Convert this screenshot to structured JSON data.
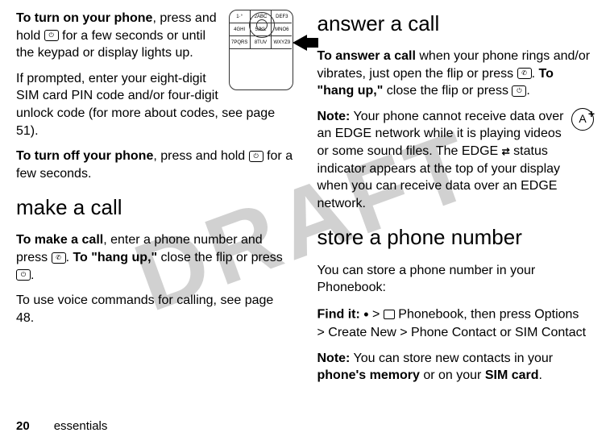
{
  "watermark": "DRAFT",
  "col1": {
    "p1a": "To turn on your phone",
    "p1b": ", press and hold ",
    "p1c": " for a few seconds or until the keypad or display lights up.",
    "p2": "If prompted, enter your eight-digit SIM card PIN code and/or four-digit unlock code (for more about codes, see page 51).",
    "p3a": "To turn off your phone",
    "p3b": ", press and hold ",
    "p3c": " for a few seconds.",
    "h_make": "make a call",
    "p4a": "To make a call",
    "p4b": ", enter a phone number and press ",
    "p4c": ". ",
    "p4d": "To \"hang up,\"",
    "p4e": " close the flip or press ",
    "p4f": ".",
    "p5": "To use voice commands for calling, see page 48.",
    "keys": [
      "1·°",
      "2ABC",
      "DEF3",
      "4GHI",
      "5JKL",
      "MNO6",
      "7PQRS",
      "8TUV",
      "WXYZ9"
    ]
  },
  "col2": {
    "h_answer": "answer a call",
    "p1a": "To answer a call",
    "p1b": " when your phone rings and/or vibrates, just open the flip or press ",
    "p1c": ". ",
    "p1d": "To \"hang up,\"",
    "p1e": " close the flip or press ",
    "p1f": ".",
    "p2a": "Note:",
    "p2b": " Your phone cannot receive data over an EDGE network while it is playing videos or some sound files. The EDGE ",
    "p2c": " status indicator appears at the top of your display when you can receive data over an EDGE network.",
    "h_store": "store a phone number",
    "p3a": "You can store a phone number in your ",
    "p3b": "Phonebook",
    "p3c": ":",
    "p4a": "Find it:",
    "p4b": " > ",
    "p4c": "Phonebook",
    "p4d": ", then press ",
    "p4e": "Options",
    "p4f": "> ",
    "p4g": "Create New",
    "p4h": " > ",
    "p4i": "Phone Contact",
    "p4j": " or ",
    "p4k": "SIM Contact",
    "p5a": "Note:",
    "p5b": " You can store new contacts in your ",
    "p5c": "phone's memory",
    "p5d": " or on your ",
    "p5e": "SIM card",
    "p5f": "."
  },
  "footer": {
    "page": "20",
    "section": "essentials"
  }
}
